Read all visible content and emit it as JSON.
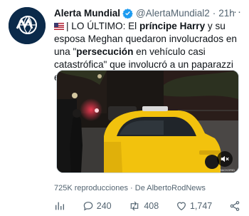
{
  "tweet": {
    "author_name": "Alerta Mundial",
    "handle": "@AlertaMundial2",
    "separator": "·",
    "time": "21h",
    "more_label": "···",
    "text": {
      "t1": "| LO ÚLTIMO: El ",
      "b1": "príncipe Harry",
      "t2": " y su esposa Meghan quedaron involucrados en una \"",
      "b2": "persecución",
      "t3": " en vehículo casi catastrófica\" que involucró a un paparazzi en Nueva York."
    },
    "media": {
      "watermark": "BACKGRID"
    },
    "views": "725K reproducciones",
    "views_sep": "·",
    "views_from": "De",
    "views_author": "AlbertoRodNews",
    "actions": {
      "replies": "240",
      "retweets": "408",
      "likes": "1,747"
    }
  },
  "colors": {
    "verified": "#1d9bf0",
    "secondary_text": "#536471",
    "taxi": "#f2c20d"
  },
  "icons": [
    "verified-icon",
    "us-flag-icon",
    "volume-off-icon",
    "analytics-icon",
    "reply-icon",
    "retweet-icon",
    "like-icon",
    "share-icon"
  ]
}
